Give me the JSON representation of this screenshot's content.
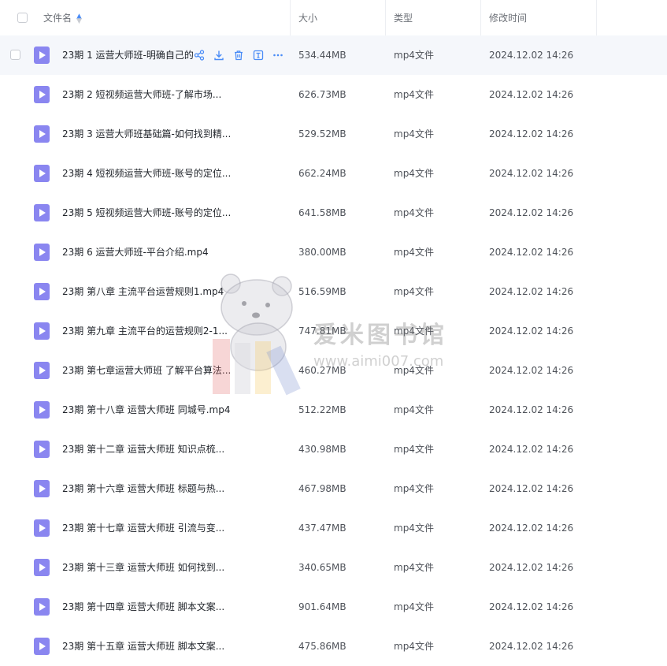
{
  "header": {
    "name_label": "文件名",
    "size_label": "大小",
    "type_label": "类型",
    "time_label": "修改时间"
  },
  "files": [
    {
      "name": "23期 1 运营大师班-明确自己的",
      "size": "534.44MB",
      "type": "mp4文件",
      "time": "2024.12.02 14:26"
    },
    {
      "name": "23期 2 短视频运营大师班-了解市场...",
      "size": "626.73MB",
      "type": "mp4文件",
      "time": "2024.12.02 14:26"
    },
    {
      "name": "23期 3 运营大师班基础篇-如何找到精...",
      "size": "529.52MB",
      "type": "mp4文件",
      "time": "2024.12.02 14:26"
    },
    {
      "name": "23期 4 短视频运营大师班-账号的定位...",
      "size": "662.24MB",
      "type": "mp4文件",
      "time": "2024.12.02 14:26"
    },
    {
      "name": "23期 5 短视频运营大师班-账号的定位...",
      "size": "641.58MB",
      "type": "mp4文件",
      "time": "2024.12.02 14:26"
    },
    {
      "name": "23期 6 运营大师班-平台介绍.mp4",
      "size": "380.00MB",
      "type": "mp4文件",
      "time": "2024.12.02 14:26"
    },
    {
      "name": "23期 第八章 主流平台运营规则1.mp4",
      "size": "516.59MB",
      "type": "mp4文件",
      "time": "2024.12.02 14:26"
    },
    {
      "name": "23期 第九章 主流平台的运营规则2-1...",
      "size": "747.81MB",
      "type": "mp4文件",
      "time": "2024.12.02 14:26"
    },
    {
      "name": "23期 第七章运营大师班 了解平台算法...",
      "size": "460.27MB",
      "type": "mp4文件",
      "time": "2024.12.02 14:26"
    },
    {
      "name": "23期 第十八章 运营大师班 同城号.mp4",
      "size": "512.22MB",
      "type": "mp4文件",
      "time": "2024.12.02 14:26"
    },
    {
      "name": "23期 第十二章 运营大师班 知识点梳...",
      "size": "430.98MB",
      "type": "mp4文件",
      "time": "2024.12.02 14:26"
    },
    {
      "name": "23期 第十六章 运营大师班 标题与热...",
      "size": "467.98MB",
      "type": "mp4文件",
      "time": "2024.12.02 14:26"
    },
    {
      "name": "23期 第十七章 运营大师班 引流与变...",
      "size": "437.47MB",
      "type": "mp4文件",
      "time": "2024.12.02 14:26"
    },
    {
      "name": "23期 第十三章 运营大师班 如何找到...",
      "size": "340.65MB",
      "type": "mp4文件",
      "time": "2024.12.02 14:26"
    },
    {
      "name": "23期 第十四章 运营大师班 脚本文案...",
      "size": "901.64MB",
      "type": "mp4文件",
      "time": "2024.12.02 14:26"
    },
    {
      "name": "23期 第十五章 运营大师班 脚本文案...",
      "size": "475.86MB",
      "type": "mp4文件",
      "time": "2024.12.02 14:26"
    }
  ],
  "watermark": {
    "title": "爱米图书馆",
    "url": "www.aimi007.com"
  }
}
